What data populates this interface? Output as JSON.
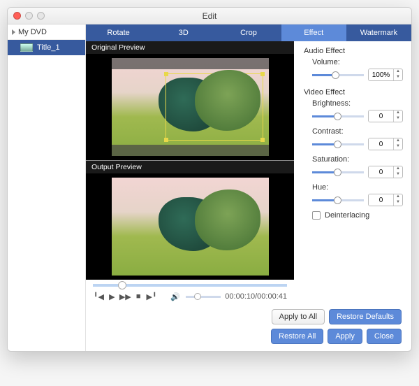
{
  "window": {
    "title": "Edit"
  },
  "sidebar": {
    "project_name": "My DVD",
    "items": [
      {
        "label": "Title_1"
      }
    ]
  },
  "tabs": [
    {
      "label": "Rotate",
      "selected": false
    },
    {
      "label": "3D",
      "selected": false
    },
    {
      "label": "Crop",
      "selected": false
    },
    {
      "label": "Effect",
      "selected": true
    },
    {
      "label": "Watermark",
      "selected": false
    }
  ],
  "previews": {
    "original_label": "Original Preview",
    "output_label": "Output Preview"
  },
  "playback": {
    "time_current": "00:00:10",
    "time_total": "00:00:41",
    "timecode": "00:00:10/00:00:41"
  },
  "effects": {
    "audio_section": "Audio Effect",
    "volume_label": "Volume:",
    "volume_value": "100%",
    "video_section": "Video Effect",
    "brightness_label": "Brightness:",
    "brightness_value": "0",
    "contrast_label": "Contrast:",
    "contrast_value": "0",
    "saturation_label": "Saturation:",
    "saturation_value": "0",
    "hue_label": "Hue:",
    "hue_value": "0",
    "deinterlacing_label": "Deinterlacing"
  },
  "buttons": {
    "apply_to_all": "Apply to All",
    "restore_defaults": "Restore Defaults",
    "restore_all": "Restore All",
    "apply": "Apply",
    "close": "Close"
  }
}
